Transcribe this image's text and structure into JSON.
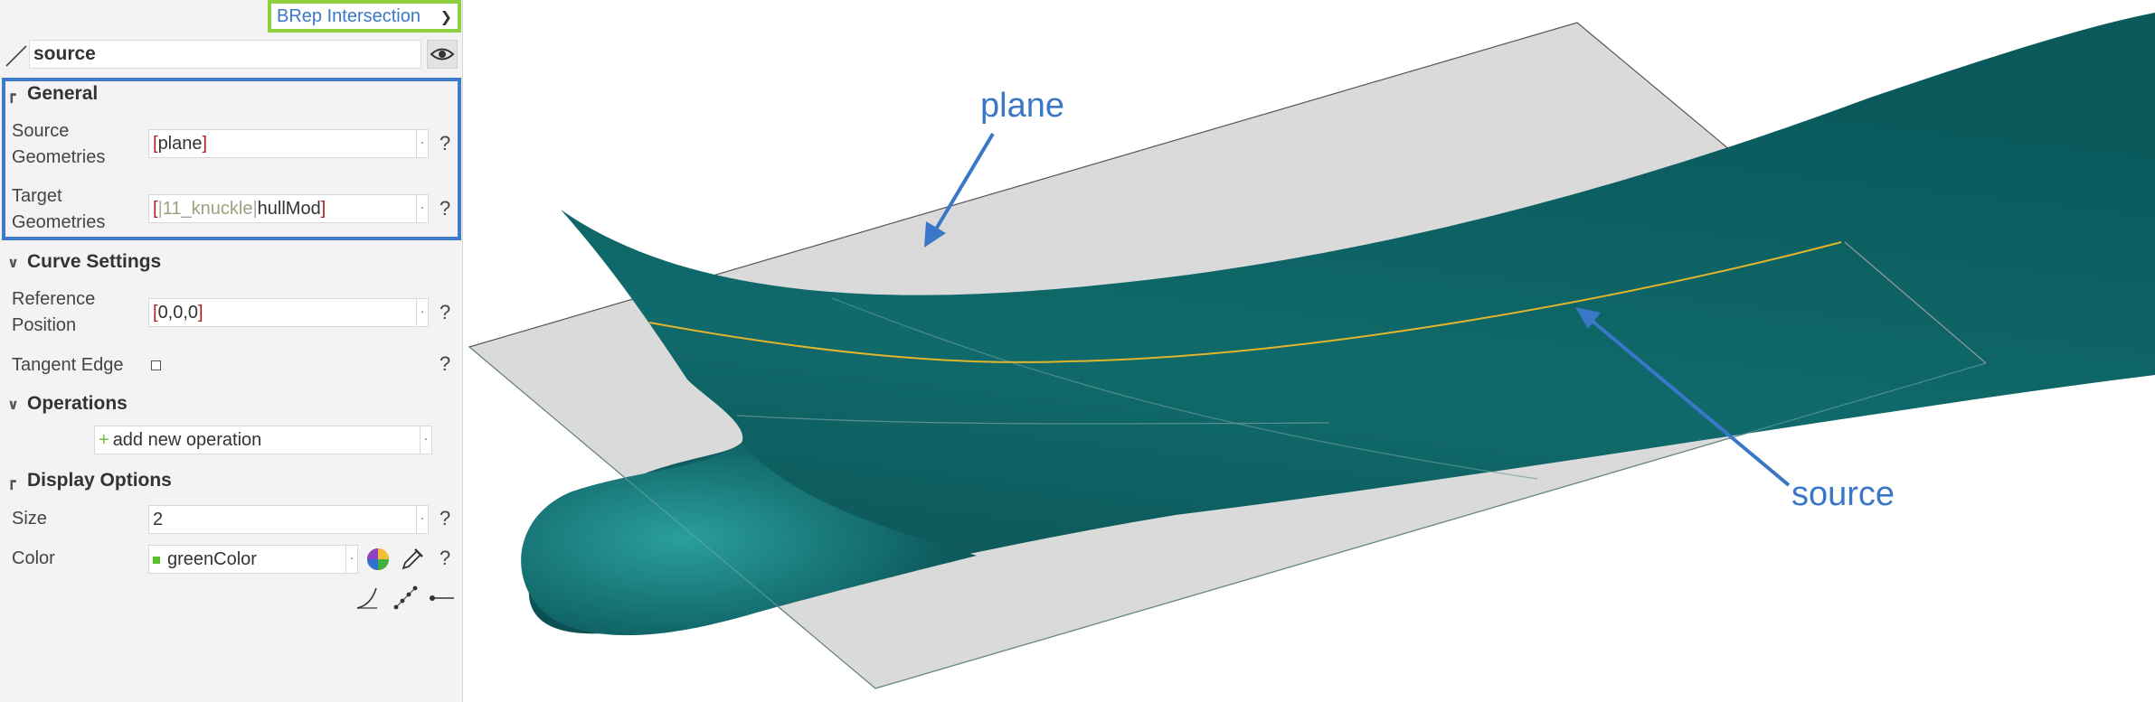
{
  "tool_selector": {
    "label": "BRep Intersection"
  },
  "object_name": {
    "value": "source"
  },
  "sections": {
    "general": {
      "title": "General"
    },
    "curve_settings": {
      "title": "Curve Settings"
    },
    "operations": {
      "title": "Operations"
    },
    "display_options": {
      "title": "Display Options"
    }
  },
  "fields": {
    "source_geometries": {
      "label_1": "Source",
      "label_2": "Geometries",
      "open": "[",
      "value": "plane",
      "close": "]"
    },
    "target_geometries": {
      "label_1": "Target",
      "label_2": "Geometries",
      "open": "[",
      "sep1": "|",
      "item1": "11_knuckle",
      "sep2": "|",
      "item2": "hullMod",
      "close": "]"
    },
    "reference_position": {
      "label_1": "Reference",
      "label_2": "Position",
      "open": "[",
      "value": "0,0,0",
      "close": "]"
    },
    "tangent_edge": {
      "label": "Tangent Edge",
      "checked": false
    },
    "add_operation": {
      "plus": "+",
      "label": "add new operation"
    },
    "size": {
      "label": "Size",
      "value": "2"
    },
    "color": {
      "label": "Color",
      "value": "greenColor",
      "swatch": "#56c02a"
    }
  },
  "help_glyph": "?",
  "icons": {
    "curve_type": "line-icon",
    "visibility": "eye-icon",
    "color_picker": "color-wheel-icon",
    "pipette": "pipette-icon",
    "curve_style": "curve-style-icon",
    "point_style": "dotted-line-icon",
    "endpoint_style": "line-endpoint-icon"
  },
  "annotations": {
    "plane": "plane",
    "source": "source"
  },
  "colors": {
    "accent": "#3a78c7",
    "selector_border": "#8dcf3f",
    "general_border": "#3f7bc9",
    "hull": "#0e5e60",
    "plane": "#dadada",
    "curve": "#e3b52c"
  }
}
